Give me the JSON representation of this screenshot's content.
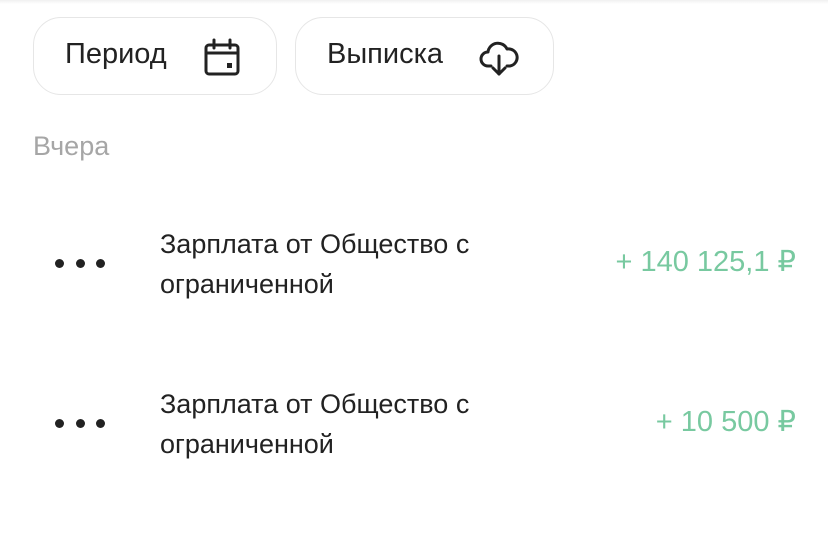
{
  "filters": {
    "period_label": "Период",
    "period_icon": "calendar-icon",
    "statement_label": "Выписка",
    "statement_icon": "cloud-download-icon"
  },
  "section": {
    "title": "Вчера"
  },
  "transactions": [
    {
      "icon": "more-dots-icon",
      "description": "Зарплата от Общество с ограниченной",
      "amount": "+ 140 125,1 ₽"
    },
    {
      "icon": "more-dots-icon",
      "description": "Зарплата от Общество с ограниченной",
      "amount": "+ 10 500 ₽"
    }
  ],
  "colors": {
    "income": "#78c9a0",
    "text": "#222222",
    "muted": "#a6a6a6",
    "border": "#e6e6e6"
  }
}
